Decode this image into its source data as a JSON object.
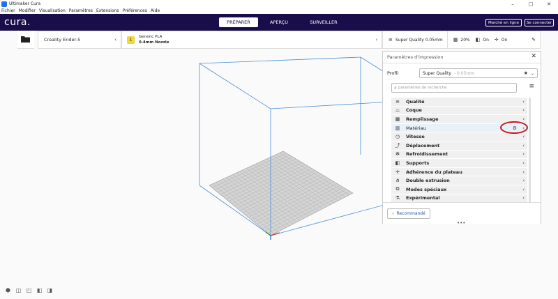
{
  "window": {
    "title": "Ultimaker Cura",
    "controls": [
      "–",
      "□",
      "✕"
    ]
  },
  "menu": [
    "Fichier",
    "Modifier",
    "Visualisation",
    "Paramètres",
    "Extensions",
    "Préférences",
    "Aide"
  ],
  "header": {
    "logo": "cura.",
    "tabs": [
      {
        "label": "PRÉPARER",
        "active": true
      },
      {
        "label": "APERÇU",
        "active": false
      },
      {
        "label": "SURVEILLER",
        "active": false
      }
    ],
    "marketplace_label": "Marché en ligne",
    "signin_label": "Se connecter"
  },
  "toolbar": {
    "printer": "Creality Ender-5",
    "material_name": "Generic PLA",
    "nozzle": "0.4mm Nozzle",
    "quality": "Super Quality 0.05mm",
    "infill": "20%",
    "support": "On",
    "adhesion": "On"
  },
  "panel": {
    "title": "Paramètres d'impression",
    "profile_label": "Profil",
    "profile_value": "Super Quality",
    "profile_sub": "- 0.05mm",
    "search_placeholder": "paramètres de recherche",
    "categories": [
      {
        "label": "Qualité",
        "icon": "≡"
      },
      {
        "label": "Coque",
        "icon": "⌓"
      },
      {
        "label": "Remplissage",
        "icon": "▦"
      },
      {
        "label": "Matériau",
        "icon": "▥"
      },
      {
        "label": "Vitesse",
        "icon": "◷"
      },
      {
        "label": "Déplacement",
        "icon": "⤴"
      },
      {
        "label": "Refroidissement",
        "icon": "✻"
      },
      {
        "label": "Supports",
        "icon": "◧"
      },
      {
        "label": "Adhérence du plateau",
        "icon": "✛"
      },
      {
        "label": "Double extrusion",
        "icon": "⋔"
      },
      {
        "label": "Modes spéciaux",
        "icon": "⧉"
      },
      {
        "label": "Expérimental",
        "icon": "⚗"
      }
    ],
    "recommended_label": "Recommandé"
  },
  "colors": {
    "header_bg": "#190e49",
    "accent": "#1e5aa8",
    "annotation": "#c4171c",
    "build_plate": "#c8c8c8",
    "volume_lines": "#4a8fd6"
  }
}
